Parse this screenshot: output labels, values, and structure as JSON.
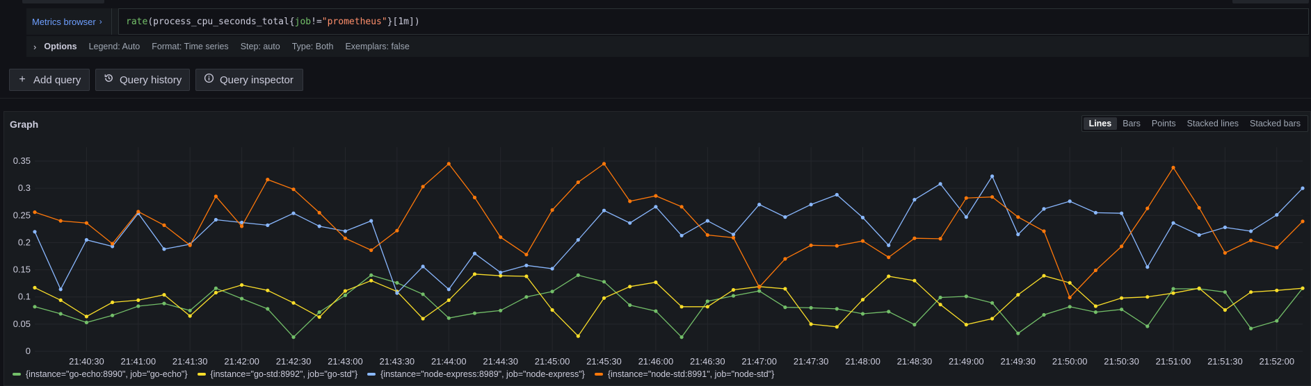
{
  "query": {
    "metrics_browser_label": "Metrics browser",
    "expr_fn": "rate",
    "expr_metric": "process_cpu_seconds_total",
    "expr_label": "job",
    "expr_op": "!=",
    "expr_value": "\"prometheus\"",
    "expr_range": "[1m]"
  },
  "options": {
    "title": "Options",
    "legend": "Legend: Auto",
    "format": "Format: Time series",
    "step": "Step: auto",
    "type": "Type: Both",
    "exemplars": "Exemplars: false"
  },
  "buttons": {
    "add_query": "Add query",
    "query_history": "Query history",
    "query_inspector": "Query inspector"
  },
  "panel": {
    "title": "Graph",
    "modes": [
      "Lines",
      "Bars",
      "Points",
      "Stacked lines",
      "Stacked bars"
    ],
    "active_mode": "Lines"
  },
  "chart_data": {
    "type": "line",
    "ylim": [
      0,
      0.35
    ],
    "y_ticks": [
      "0",
      "0.05",
      "0.1",
      "0.15",
      "0.2",
      "0.25",
      "0.3",
      "0.35"
    ],
    "x_ticks": [
      "21:40:30",
      "21:41:00",
      "21:41:30",
      "21:42:00",
      "21:42:30",
      "21:43:00",
      "21:43:30",
      "21:44:00",
      "21:44:30",
      "21:45:00",
      "21:45:30",
      "21:46:00",
      "21:46:30",
      "21:47:00",
      "21:47:30",
      "21:48:00",
      "21:48:30",
      "21:49:00",
      "21:49:30",
      "21:50:00",
      "21:50:30",
      "21:51:00",
      "21:51:30",
      "21:52:00"
    ],
    "x_start": "21:40:00",
    "x_step_seconds": 15,
    "grid": true,
    "legend_position": "bottom",
    "series": [
      {
        "name": "{instance=\"go-echo:8990\", job=\"go-echo\"}",
        "color": "#73bf69",
        "values": [
          0.082,
          0.069,
          0.053,
          0.066,
          0.083,
          0.088,
          0.075,
          0.116,
          0.097,
          0.078,
          0.026,
          0.072,
          0.103,
          0.14,
          0.126,
          0.105,
          0.061,
          0.07,
          0.075,
          0.1,
          0.11,
          0.14,
          0.128,
          0.085,
          0.074,
          0.026,
          0.092,
          0.102,
          0.111,
          0.081,
          0.08,
          0.078,
          0.069,
          0.073,
          0.049,
          0.099,
          0.101,
          0.089,
          0.033,
          0.067,
          0.082,
          0.072,
          0.077,
          0.046,
          0.115,
          0.115,
          0.109,
          0.042,
          0.056,
          0.116
        ]
      },
      {
        "name": "{instance=\"go-std:8992\", job=\"go-std\"}",
        "color": "#fade2a",
        "values": [
          0.117,
          0.094,
          0.064,
          0.09,
          0.094,
          0.104,
          0.065,
          0.108,
          0.122,
          0.112,
          0.089,
          0.063,
          0.111,
          0.13,
          0.11,
          0.06,
          0.094,
          0.142,
          0.139,
          0.138,
          0.076,
          0.028,
          0.098,
          0.119,
          0.127,
          0.082,
          0.082,
          0.113,
          0.119,
          0.115,
          0.05,
          0.045,
          0.095,
          0.138,
          0.13,
          0.086,
          0.049,
          0.06,
          0.104,
          0.139,
          0.126,
          0.083,
          0.098,
          0.1,
          0.107,
          0.116,
          0.076,
          0.109,
          0.112,
          0.116
        ]
      },
      {
        "name": "{instance=\"node-express:8989\", job=\"node-express\"}",
        "color": "#8ab8ff",
        "values": [
          0.22,
          0.114,
          0.205,
          0.193,
          0.254,
          0.188,
          0.197,
          0.242,
          0.237,
          0.232,
          0.254,
          0.23,
          0.221,
          0.24,
          0.107,
          0.156,
          0.114,
          0.18,
          0.145,
          0.158,
          0.152,
          0.205,
          0.259,
          0.236,
          0.266,
          0.213,
          0.24,
          0.215,
          0.27,
          0.247,
          0.27,
          0.288,
          0.246,
          0.195,
          0.279,
          0.308,
          0.247,
          0.322,
          0.215,
          0.262,
          0.276,
          0.255,
          0.254,
          0.155,
          0.236,
          0.214,
          0.228,
          0.221,
          0.251,
          0.3
        ]
      },
      {
        "name": "{instance=\"node-std:8991\", job=\"node-std\"}",
        "color": "#ff780a",
        "values": [
          0.256,
          0.24,
          0.236,
          0.198,
          0.257,
          0.232,
          0.195,
          0.285,
          0.23,
          0.316,
          0.298,
          0.255,
          0.208,
          0.186,
          0.222,
          0.303,
          0.345,
          0.283,
          0.21,
          0.178,
          0.26,
          0.311,
          0.345,
          0.276,
          0.286,
          0.266,
          0.214,
          0.209,
          0.118,
          0.17,
          0.195,
          0.194,
          0.203,
          0.173,
          0.208,
          0.207,
          0.282,
          0.284,
          0.247,
          0.221,
          0.099,
          0.149,
          0.193,
          0.263,
          0.338,
          0.264,
          0.181,
          0.204,
          0.191,
          0.239
        ]
      }
    ]
  }
}
